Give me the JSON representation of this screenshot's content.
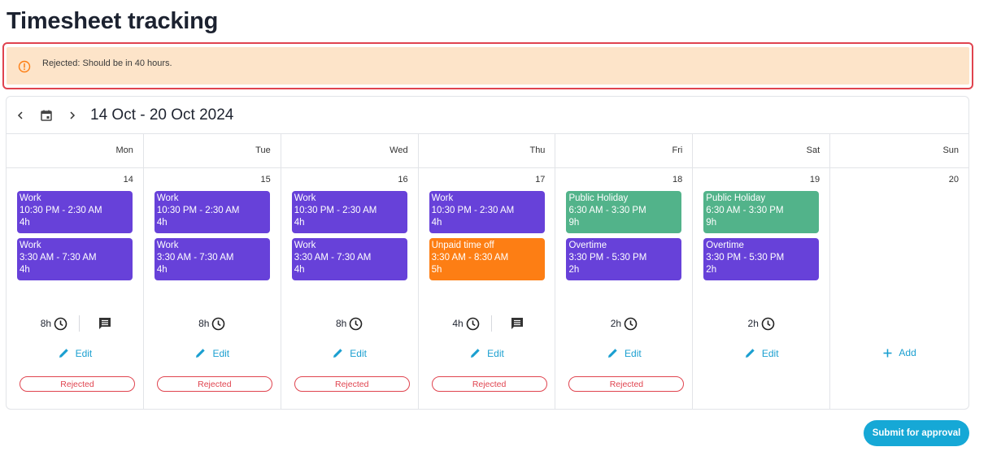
{
  "page": {
    "title": "Timesheet tracking"
  },
  "alert": {
    "message": "Rejected: Should be in 40 hours.",
    "icon": "warning-circle-icon",
    "color": "#fd7e14"
  },
  "calendar": {
    "range": "14 Oct - 20 Oct 2024",
    "days": [
      {
        "name": "Mon",
        "date": "14",
        "events": [
          {
            "title": "Work",
            "time": "10:30 PM - 2:30 AM",
            "duration": "4h",
            "color": "#6741d9"
          },
          {
            "title": "Work",
            "time": "3:30 AM - 7:30 AM",
            "duration": "4h",
            "color": "#6741d9"
          }
        ],
        "total": "8h",
        "action": "Edit",
        "status": "Rejected"
      },
      {
        "name": "Tue",
        "date": "15",
        "events": [
          {
            "title": "Work",
            "time": "10:30 PM - 2:30 AM",
            "duration": "4h",
            "color": "#6741d9"
          },
          {
            "title": "Work",
            "time": "3:30 AM - 7:30 AM",
            "duration": "4h",
            "color": "#6741d9"
          }
        ],
        "total": "8h",
        "action": "Edit",
        "status": "Rejected"
      },
      {
        "name": "Wed",
        "date": "16",
        "events": [
          {
            "title": "Work",
            "time": "10:30 PM - 2:30 AM",
            "duration": "4h",
            "color": "#6741d9"
          },
          {
            "title": "Work",
            "time": "3:30 AM - 7:30 AM",
            "duration": "4h",
            "color": "#6741d9"
          }
        ],
        "total": "8h",
        "action": "Edit",
        "status": "Rejected"
      },
      {
        "name": "Thu",
        "date": "17",
        "events": [
          {
            "title": "Work",
            "time": "10:30 PM - 2:30 AM",
            "duration": "4h",
            "color": "#6741d9"
          },
          {
            "title": "Unpaid time off",
            "time": "3:30 AM - 8:30 AM",
            "duration": "5h",
            "color": "#fd7e14"
          }
        ],
        "total": "4h",
        "action": "Edit",
        "status": "Rejected"
      },
      {
        "name": "Fri",
        "date": "18",
        "events": [
          {
            "title": "Public Holiday",
            "time": "6:30 AM - 3:30 PM",
            "duration": "9h",
            "color": "#52b38a"
          },
          {
            "title": "Overtime",
            "time": "3:30 PM - 5:30 PM",
            "duration": "2h",
            "color": "#6741d9"
          }
        ],
        "total": "2h",
        "action": "Edit",
        "status": "Rejected"
      },
      {
        "name": "Sat",
        "date": "19",
        "events": [
          {
            "title": "Public Holiday",
            "time": "6:30 AM - 3:30 PM",
            "duration": "9h",
            "color": "#52b38a"
          },
          {
            "title": "Overtime",
            "time": "3:30 PM - 5:30 PM",
            "duration": "2h",
            "color": "#6741d9"
          }
        ],
        "total": "2h",
        "action": "Edit"
      },
      {
        "name": "Sun",
        "date": "20",
        "action": "Add"
      }
    ]
  },
  "footer": {
    "submit_label": "Submit for approval"
  },
  "colors": {
    "accent": "#16a8d6",
    "rejected": "#e0444f",
    "work": "#6741d9",
    "holiday": "#52b38a",
    "time_off": "#fd7e14"
  }
}
